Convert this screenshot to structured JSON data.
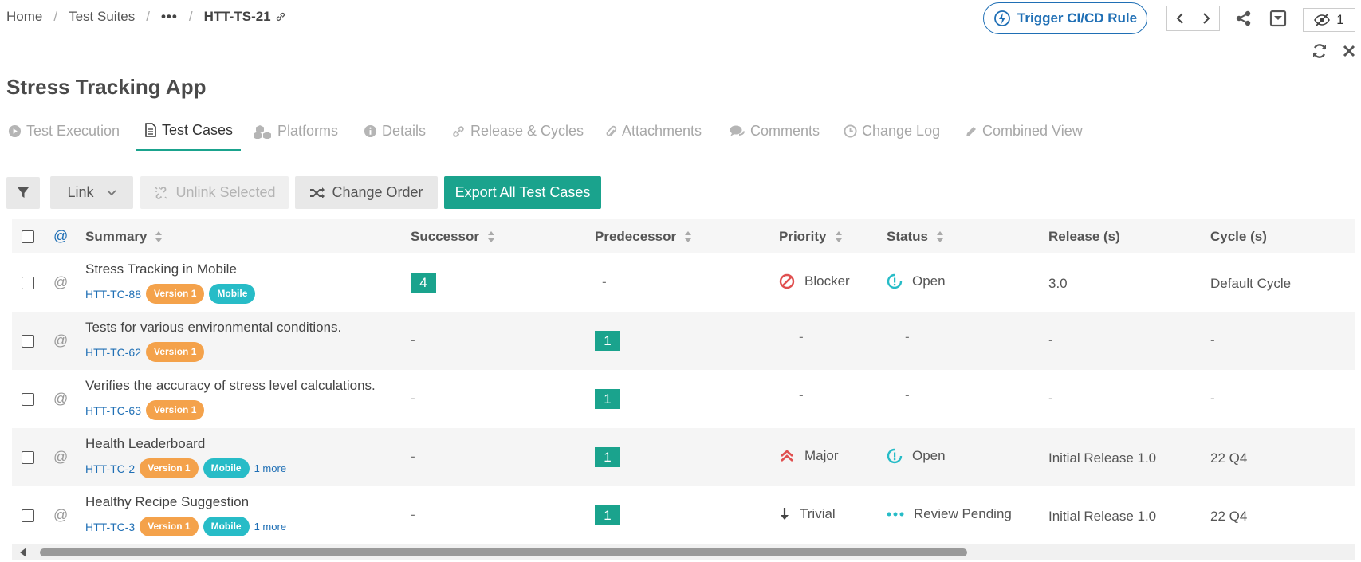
{
  "breadcrumb": {
    "home": "Home",
    "suites": "Test Suites",
    "ellipsis": "•••",
    "current": "HTT-TS-21"
  },
  "header": {
    "trigger_label": "Trigger CI/CD Rule",
    "watch_count": "1"
  },
  "page_title": "Stress Tracking App",
  "tabs": [
    {
      "label": "Test Execution",
      "icon": "play-circle-icon"
    },
    {
      "label": "Test Cases",
      "icon": "document-icon",
      "active": true
    },
    {
      "label": "Platforms",
      "icon": "cubes-icon"
    },
    {
      "label": "Details",
      "icon": "info-circle-icon"
    },
    {
      "label": "Release & Cycles",
      "icon": "link-icon"
    },
    {
      "label": "Attachments",
      "icon": "paperclip-icon"
    },
    {
      "label": "Comments",
      "icon": "comments-icon"
    },
    {
      "label": "Change Log",
      "icon": "clock-icon"
    },
    {
      "label": "Combined View",
      "icon": "pencil-icon"
    }
  ],
  "toolbar": {
    "link_label": "Link",
    "unlink_label": "Unlink Selected",
    "change_order_label": "Change Order",
    "export_label": "Export All Test Cases"
  },
  "table": {
    "headers": {
      "at": "@",
      "summary": "Summary",
      "successor": "Successor",
      "predecessor": "Predecessor",
      "priority": "Priority",
      "status": "Status",
      "release": "Release (s)",
      "cycle": "Cycle (s)"
    },
    "rows": [
      {
        "summary": "Stress Tracking in Mobile",
        "key": "HTT-TC-88",
        "version": "Version 1",
        "platform": "Mobile",
        "more": "",
        "successor": "4",
        "predecessor": "-",
        "priority": "Blocker",
        "status": "Open",
        "release": "3.0",
        "cycle": "Default Cycle"
      },
      {
        "summary": "Tests for various environmental conditions.",
        "key": "HTT-TC-62",
        "version": "Version 1",
        "platform": "",
        "more": "",
        "successor": "-",
        "predecessor": "1",
        "priority": "-",
        "status": "-",
        "release": "-",
        "cycle": "-"
      },
      {
        "summary": "Verifies the accuracy of stress level calculations.",
        "key": "HTT-TC-63",
        "version": "Version 1",
        "platform": "",
        "more": "",
        "successor": "-",
        "predecessor": "1",
        "priority": "-",
        "status": "-",
        "release": "-",
        "cycle": "-"
      },
      {
        "summary": "Health Leaderboard",
        "key": "HTT-TC-2",
        "version": "Version 1",
        "platform": "Mobile",
        "more": "1 more",
        "successor": "-",
        "predecessor": "1",
        "priority": "Major",
        "status": "Open",
        "release": "Initial Release 1.0",
        "cycle": "22 Q4"
      },
      {
        "summary": "Healthy Recipe Suggestion",
        "key": "HTT-TC-3",
        "version": "Version 1",
        "platform": "Mobile",
        "more": "1 more",
        "successor": "-",
        "predecessor": "1",
        "priority": "Trivial",
        "status": "Review Pending",
        "release": "Initial Release 1.0",
        "cycle": "22 Q4"
      }
    ]
  },
  "colors": {
    "accent": "#1aa38d",
    "link": "#1f6fb5",
    "badge_orange": "#f4a24b",
    "badge_teal": "#27bcc7",
    "blocker": "#e05050",
    "status_open": "#27bcc7"
  }
}
